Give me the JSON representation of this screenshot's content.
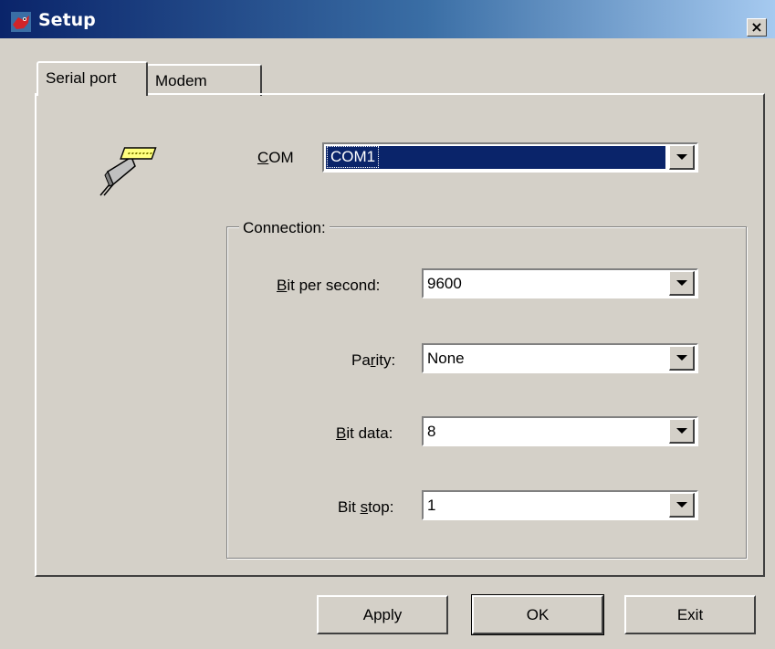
{
  "window": {
    "title": "Setup",
    "close_label": "×"
  },
  "tabs": [
    {
      "label": "Serial port",
      "active": true
    },
    {
      "label": "Modem",
      "active": false
    }
  ],
  "com": {
    "label_hot": "C",
    "label_rest": "OM",
    "value": "COM1"
  },
  "connection": {
    "legend": "Connection:",
    "bit_per_second": {
      "label_hot": "B",
      "label_rest": "it per second:",
      "value": "9600"
    },
    "parity": {
      "label_pre": "Pa",
      "label_hot": "r",
      "label_rest": "ity:",
      "value": "None"
    },
    "bit_data": {
      "label_hot": "B",
      "label_rest": "it data:",
      "value": "8"
    },
    "bit_stop": {
      "label_pre": "Bit ",
      "label_hot": "s",
      "label_rest": "top:",
      "value": "1"
    }
  },
  "buttons": {
    "apply": "Apply",
    "ok": "OK",
    "exit": "Exit"
  },
  "icons": {
    "app": "frog-app-icon",
    "serial": "serial-cable-icon"
  },
  "colors": {
    "title_start": "#0a246a",
    "title_end": "#a6caf0",
    "selection": "#0a246a",
    "face": "#d4d0c8"
  }
}
